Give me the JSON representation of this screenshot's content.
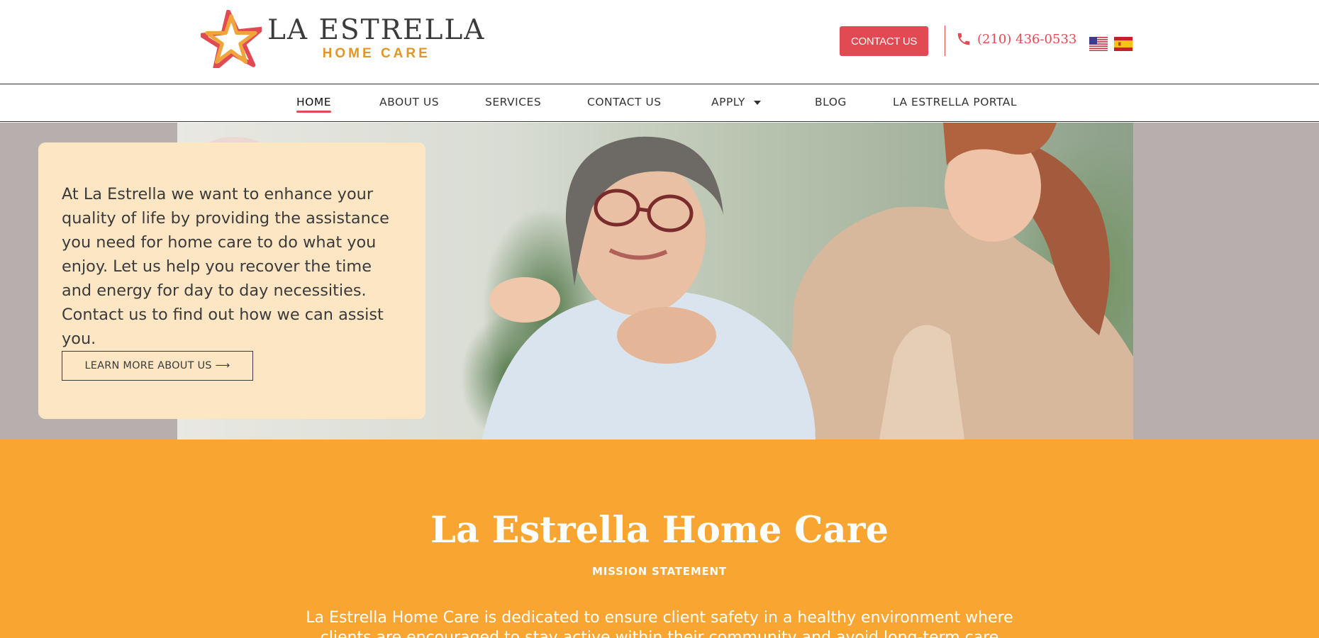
{
  "brand": {
    "name": "LA ESTRELLA",
    "tagline": "HOME CARE",
    "colors": {
      "red": "#e24a53",
      "gold": "#e0962a",
      "orange": "#f8a631",
      "cream": "#fde6c4"
    }
  },
  "header": {
    "contact_button": "CONTACT US",
    "phone": "(210) 436-0533",
    "phone_icon": "phone-icon",
    "languages": [
      "English (US flag)",
      "Spanish (Spain flag)"
    ]
  },
  "nav": {
    "items": [
      {
        "label": "HOME",
        "active": true
      },
      {
        "label": "ABOUT US",
        "active": false
      },
      {
        "label": "SERVICES",
        "active": false
      },
      {
        "label": "CONTACT US",
        "active": false
      },
      {
        "label": "APPLY",
        "active": false,
        "has_dropdown": true
      },
      {
        "label": "BLOG",
        "active": false
      },
      {
        "label": "LA ESTRELLA PORTAL",
        "active": false
      }
    ]
  },
  "hero": {
    "text": "At La Estrella we want to enhance your quality of life by providing the assistance you need for home care to do what you enjoy. Let us help you recover the time and energy for day to day necessities. Contact us to find out how we can assist you.",
    "button": "LEARN MORE ABOUT US ⟶"
  },
  "mission": {
    "title": "La Estrella Home Care",
    "subtitle": "MISSION STATEMENT",
    "text": "La Estrella Home Care is dedicated to ensure client safety in a healthy environment where clients are encouraged to stay active within their community and avoid long-term care facilities."
  }
}
